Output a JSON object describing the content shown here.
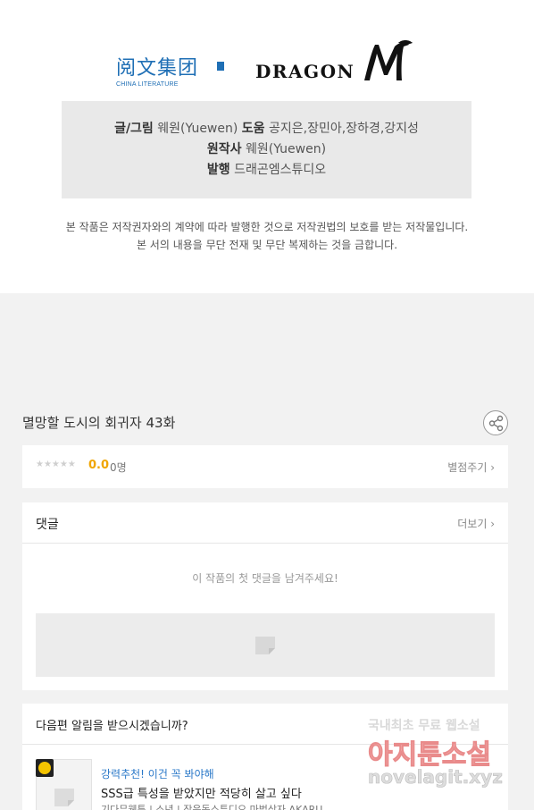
{
  "logos": {
    "china_literature_cn": "阅文集团",
    "china_literature_en": "CHINA LITERATURE",
    "dragon_word": "DRAGON"
  },
  "credits": {
    "line1_label_a": "글/그림",
    "line1_value_a": "웨원(Yuewen)",
    "line1_label_b": "도움",
    "line1_value_b": "공지은,장민아,장하경,강지성",
    "line2_label": "원작사",
    "line2_value": "웨원(Yuewen)",
    "line3_label": "발행",
    "line3_value": "드래곤엠스튜디오"
  },
  "notice": {
    "line1": "본 작품은 저작권자와의 계약에 따라 발행한 것으로 저작권법의 보호를 받는 저작물입니다.",
    "line2": "본 서의 내용을 무단 전재 및 무단 복제하는 것을 금합니다."
  },
  "episode": {
    "title": "멸망할 도시의 회귀자 43화"
  },
  "rating": {
    "stars": "★★★★★",
    "score": "0.0",
    "count": "0명",
    "rate_button": "별점주기 ›"
  },
  "comments": {
    "title": "댓글",
    "more": "더보기 ›",
    "empty": "이 작품의 첫 댓글을 남겨주세요!"
  },
  "alarm": {
    "title": "다음편 알림을 받으시겠습니까?",
    "recommend_label": "강력추천! 이건 꼭 봐야해",
    "recommend_title": "SSS급 특성을 받았지만 적당히 살고 싶다",
    "recommend_meta": "기다무웹툰 | 소년 | 작은동스튜디오,마법상자,AKARU"
  },
  "watermark": {
    "line1": "국내최초 무료 웹소설",
    "line2": "아지툰소설",
    "line3": "novelagit.xyz"
  },
  "colors": {
    "accent_blue": "#1f6fb5",
    "score_orange": "#f0a500",
    "link_blue": "#2a78c8"
  }
}
